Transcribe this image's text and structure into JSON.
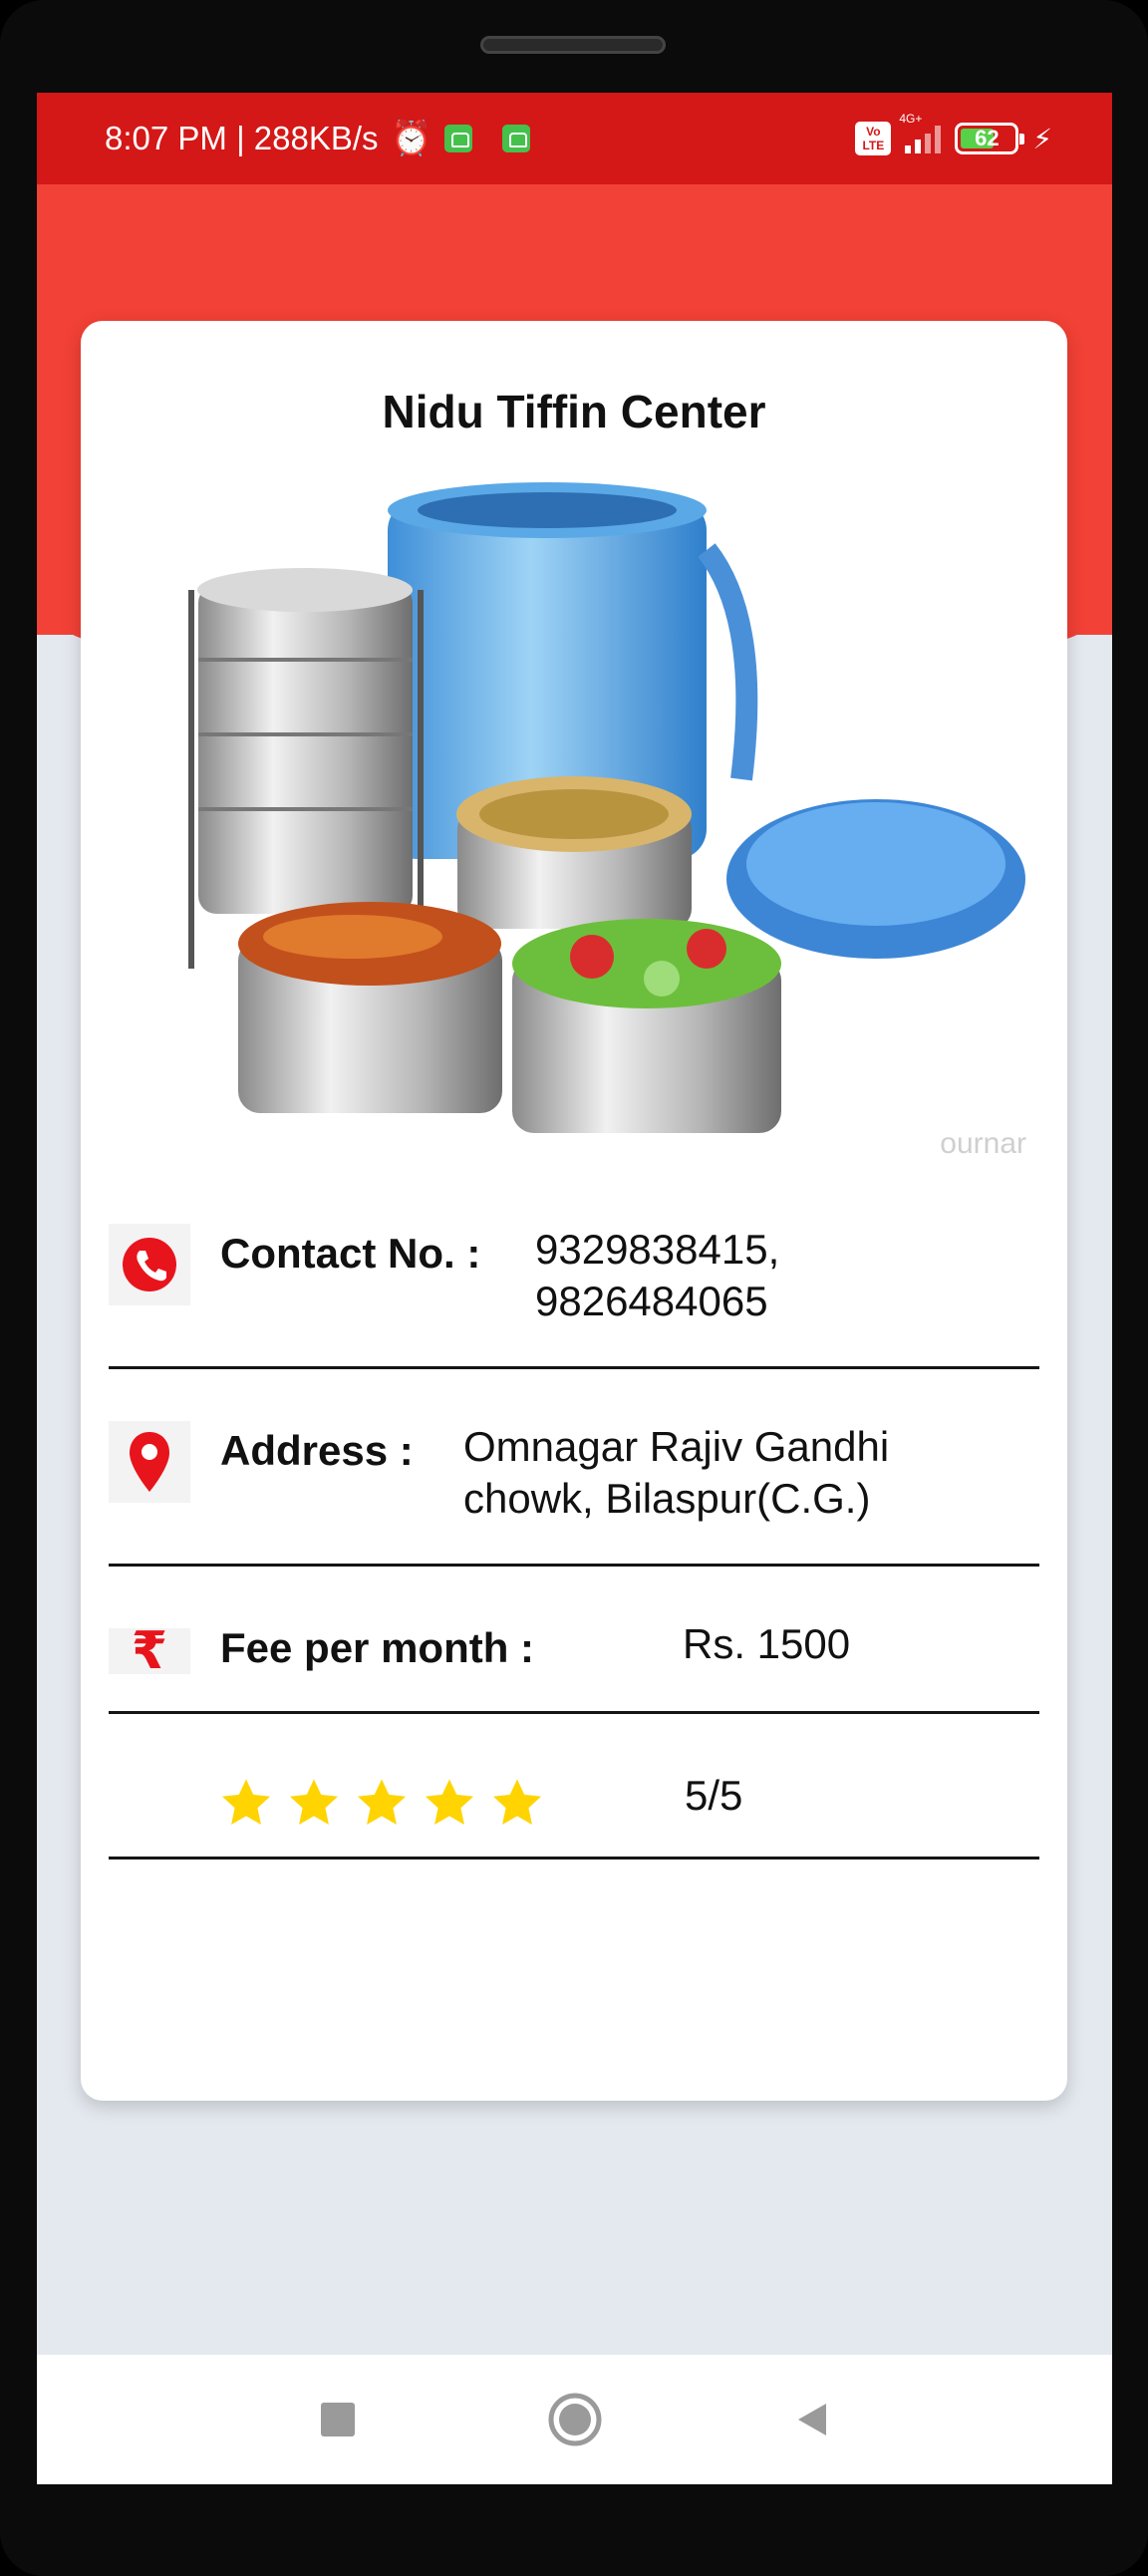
{
  "status_bar": {
    "time_speed": "8:07 PM | 288KB/s",
    "volte_label": "Vo\nLTE",
    "network": "4G+",
    "battery": "62",
    "icons": [
      "alarm-icon",
      "app-notification-icon",
      "app-notification-icon",
      "volte-icon",
      "signal-icon",
      "battery-icon",
      "charging-icon"
    ]
  },
  "card": {
    "title": "Nidu Tiffin Center",
    "image_watermark": "ournar"
  },
  "details": {
    "contact": {
      "label": "Contact No. :",
      "value_line1": "9329838415,",
      "value_line2": "9826484065",
      "icon": "phone-icon"
    },
    "address": {
      "label": "Address :",
      "value_line1": "Omnagar Rajiv Gandhi",
      "value_line2": "chowk, Bilaspur(C.G.)",
      "icon": "location-pin-icon"
    },
    "fee": {
      "label": "Fee per month :",
      "value": "Rs. 1500",
      "icon": "rupee-icon"
    },
    "rating": {
      "stars": 5,
      "max": 5,
      "text": "5/5",
      "icon": "star-icon"
    }
  },
  "colors": {
    "status_bar": "#d41717",
    "header_red": "#f24136",
    "background": "#e4e9ef",
    "icon_red": "#e8141c",
    "star_yellow": "#ffd400"
  },
  "nav_bar": {
    "icons": [
      "recent-apps-icon",
      "home-icon",
      "back-icon"
    ]
  }
}
